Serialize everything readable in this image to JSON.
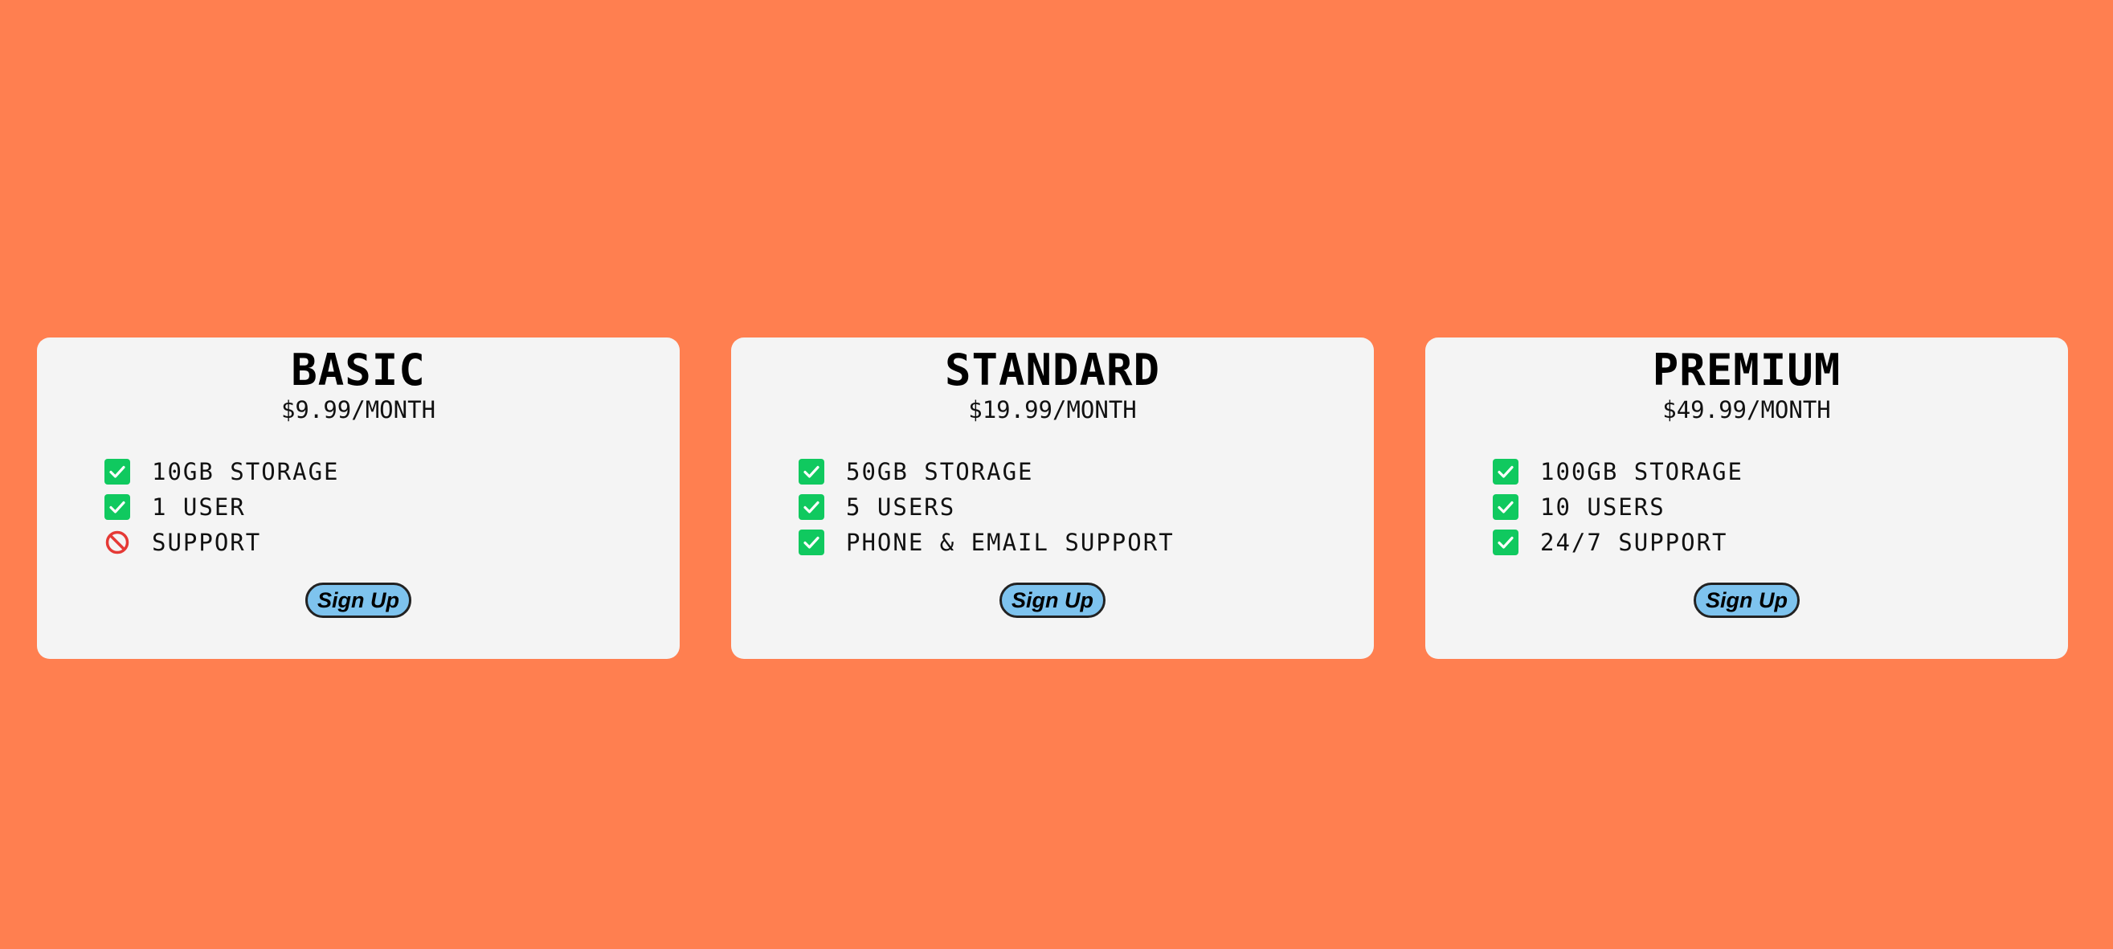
{
  "colors": {
    "background": "#ff7f50",
    "card": "#f4f4f4",
    "check": "#10c95f",
    "not_included": "#e53935",
    "button": "#7ec3ee"
  },
  "plans": [
    {
      "name": "BASIC",
      "price": "$9.99/MONTH",
      "features": [
        {
          "text": "10GB STORAGE",
          "icon": "check-icon",
          "included": true
        },
        {
          "text": "1 USER",
          "icon": "check-icon",
          "included": true
        },
        {
          "text": "SUPPORT",
          "icon": "prohibited-icon",
          "included": false
        }
      ],
      "button_label": "Sign Up"
    },
    {
      "name": "STANDARD",
      "price": "$19.99/MONTH",
      "features": [
        {
          "text": "50GB STORAGE",
          "icon": "check-icon",
          "included": true
        },
        {
          "text": "5 USERS",
          "icon": "check-icon",
          "included": true
        },
        {
          "text": "PHONE & EMAIL SUPPORT",
          "icon": "check-icon",
          "included": true
        }
      ],
      "button_label": "Sign Up"
    },
    {
      "name": "PREMIUM",
      "price": "$49.99/MONTH",
      "features": [
        {
          "text": "100GB STORAGE",
          "icon": "check-icon",
          "included": true
        },
        {
          "text": "10 USERS",
          "icon": "check-icon",
          "included": true
        },
        {
          "text": "24/7 SUPPORT",
          "icon": "check-icon",
          "included": true
        }
      ],
      "button_label": "Sign Up"
    }
  ]
}
